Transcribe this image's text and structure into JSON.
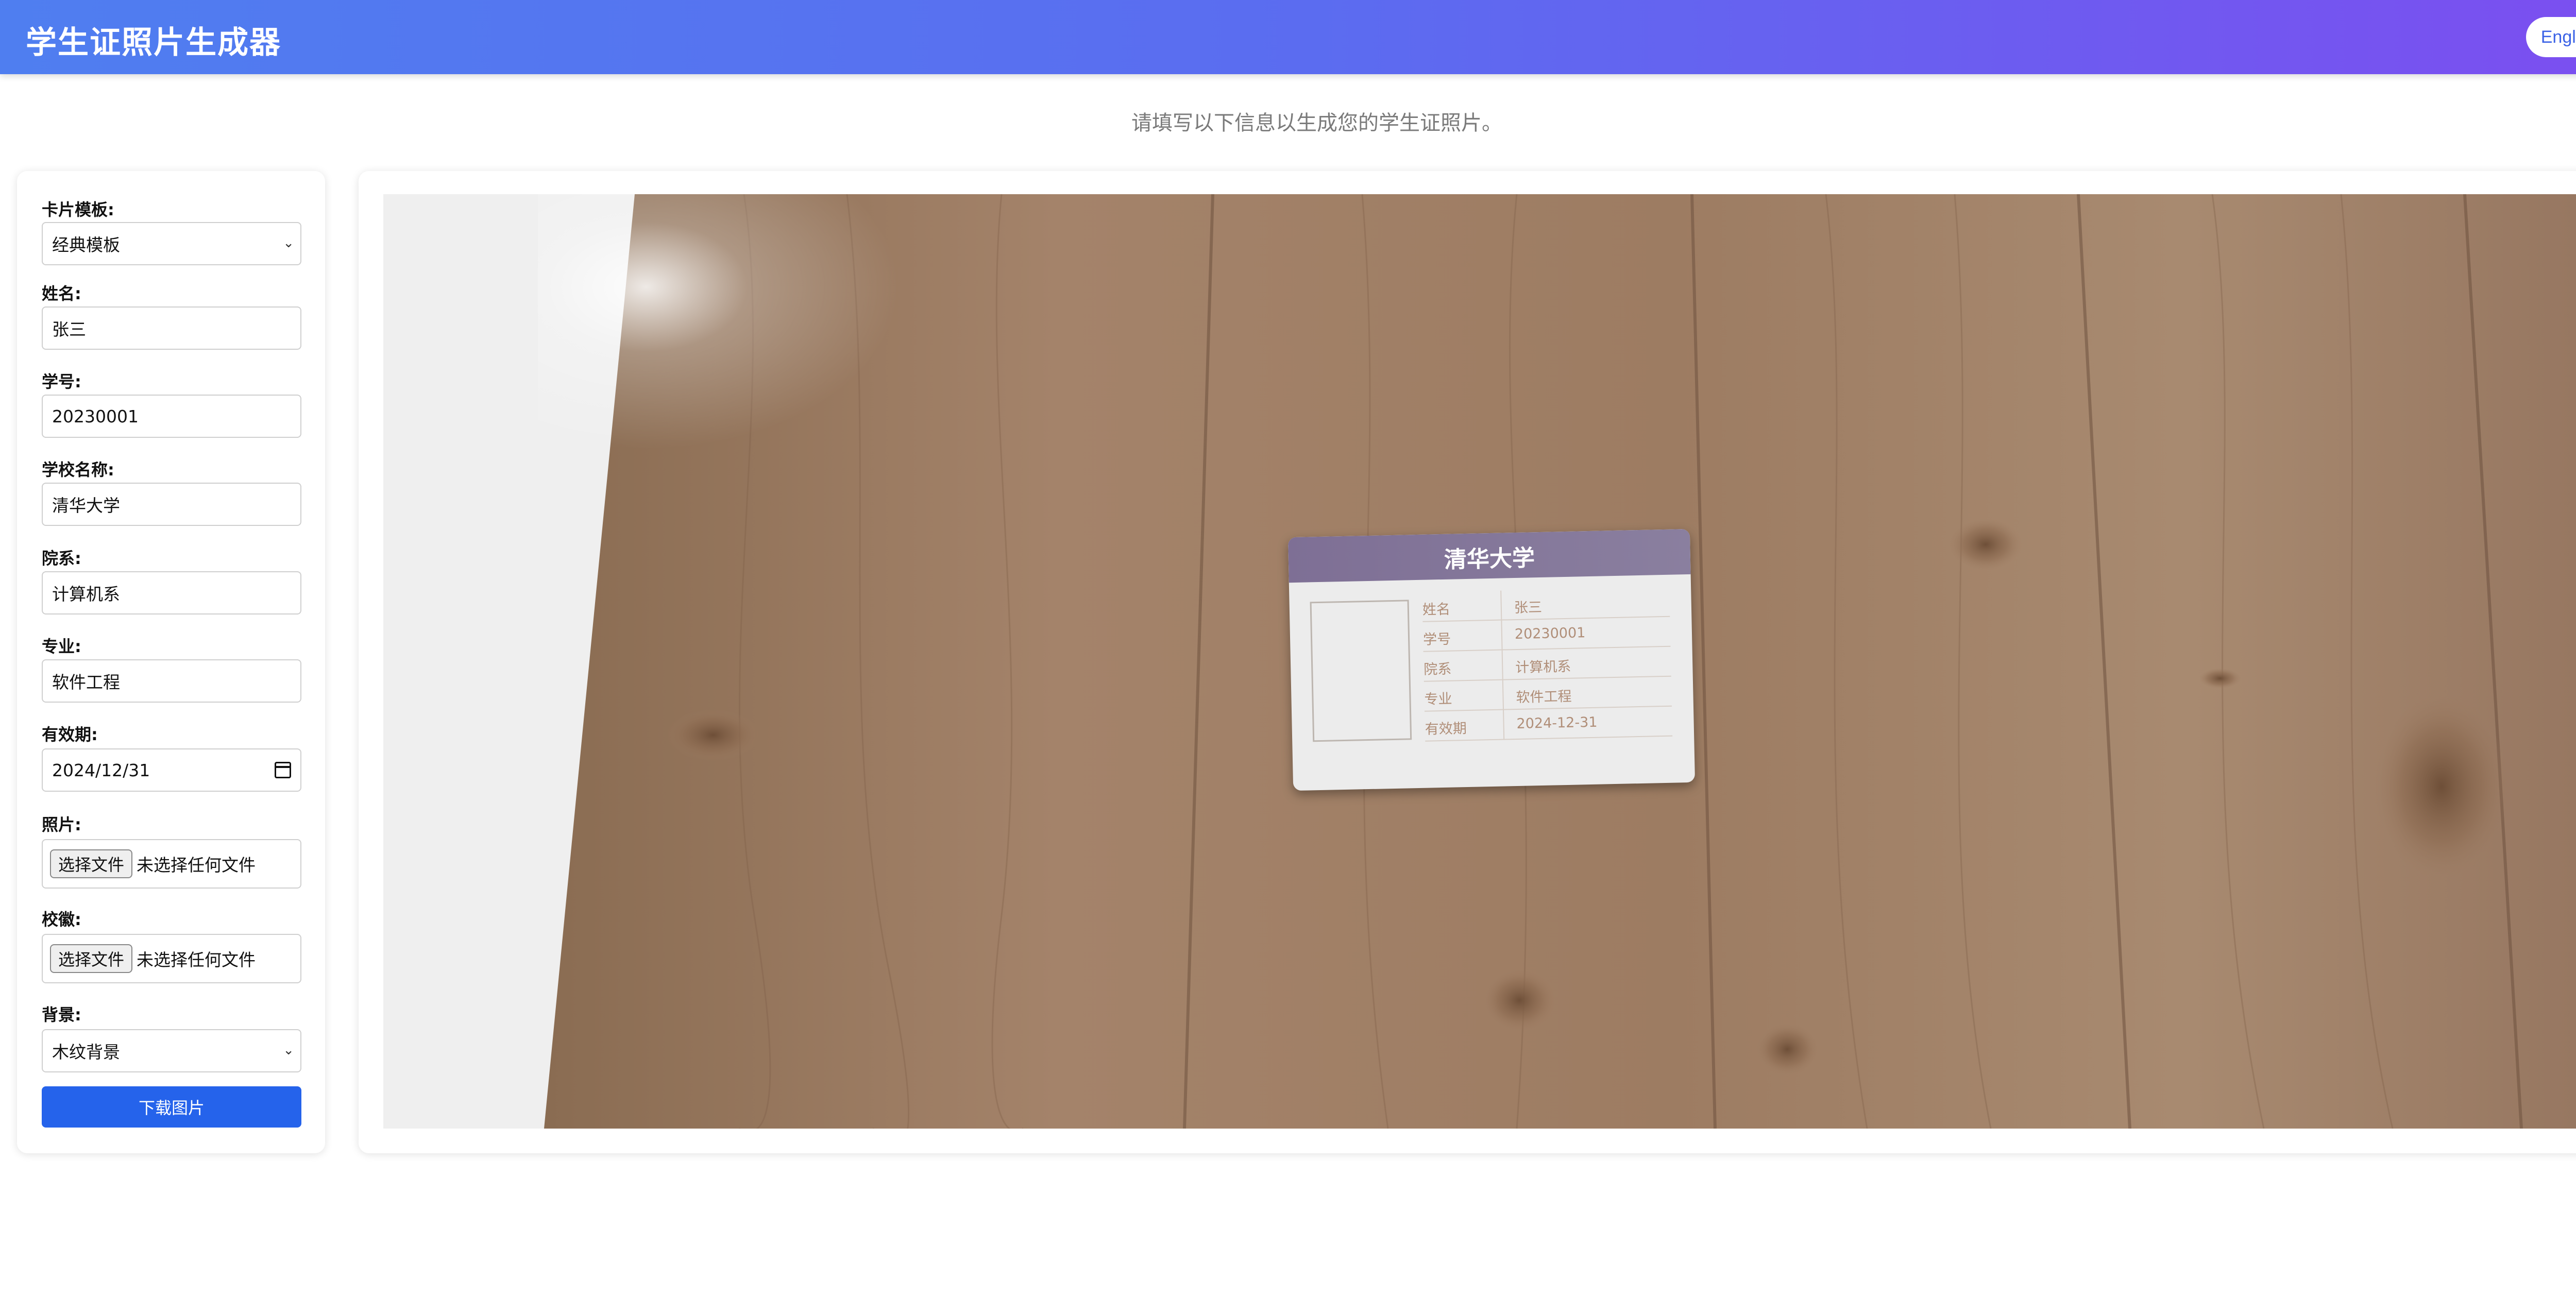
{
  "header": {
    "title": "学生证照片生成器",
    "language_button": "English"
  },
  "subtitle": "请填写以下信息以生成您的学生证照片。",
  "form": {
    "template": {
      "label": "卡片模板:",
      "value": "经典模板"
    },
    "name": {
      "label": "姓名:",
      "value": "张三"
    },
    "student_id": {
      "label": "学号:",
      "value": "20230001"
    },
    "school": {
      "label": "学校名称:",
      "value": "清华大学"
    },
    "department": {
      "label": "院系:",
      "value": "计算机系"
    },
    "major": {
      "label": "专业:",
      "value": "软件工程"
    },
    "expiry": {
      "label": "有效期:",
      "value": "2024/12/31"
    },
    "photo": {
      "label": "照片:",
      "button": "选择文件",
      "status": "未选择任何文件"
    },
    "emblem": {
      "label": "校徽:",
      "button": "选择文件",
      "status": "未选择任何文件"
    },
    "background": {
      "label": "背景:",
      "value": "木纹背景"
    },
    "download_button": "下载图片"
  },
  "preview": {
    "card": {
      "school": "清华大学",
      "rows": [
        {
          "key": "姓名",
          "value": "张三"
        },
        {
          "key": "学号",
          "value": "20230001"
        },
        {
          "key": "院系",
          "value": "计算机系"
        },
        {
          "key": "专业",
          "value": "软件工程"
        },
        {
          "key": "有效期",
          "value": "2024-12-31"
        }
      ]
    }
  },
  "colors": {
    "header_gradient_start": "#4f7ef0",
    "header_gradient_end": "#7c4ef0",
    "primary_button": "#2563eb",
    "wood": "#a07f62"
  }
}
